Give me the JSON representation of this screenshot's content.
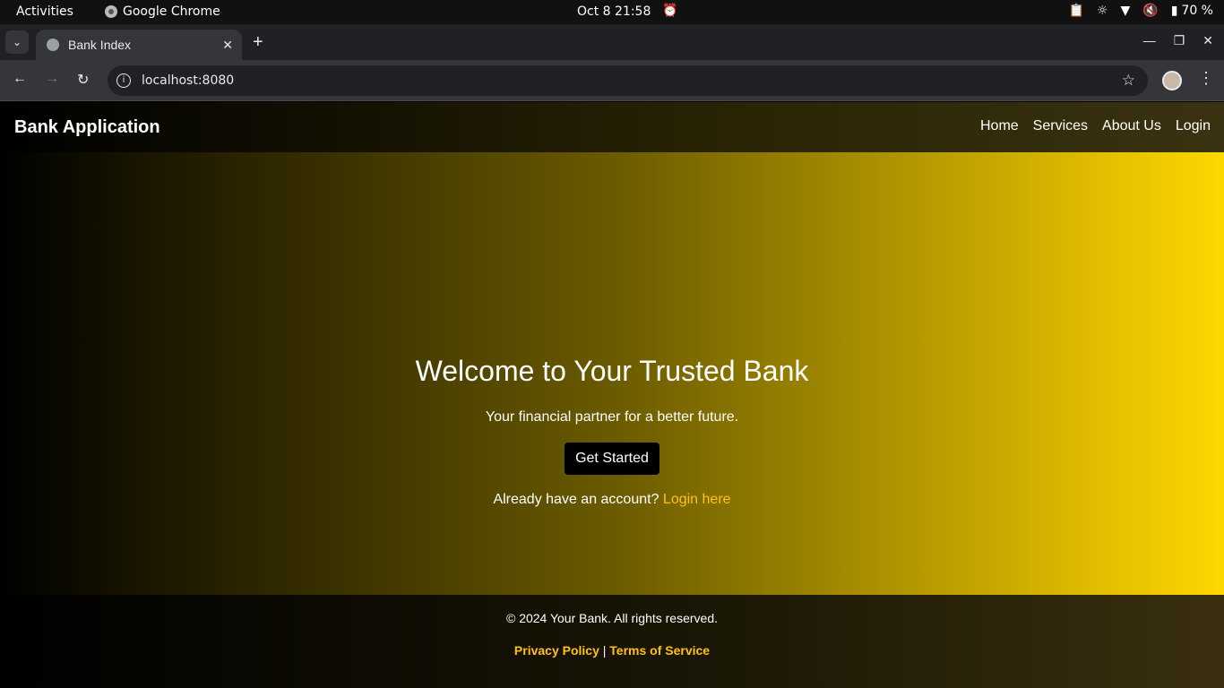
{
  "system": {
    "activities": "Activities",
    "app_name": "Google Chrome",
    "clock": "Oct 8  21:58",
    "battery": "70 %"
  },
  "browser": {
    "tab_title": "Bank Index",
    "url": "localhost:8080"
  },
  "site": {
    "brand": "Bank Application",
    "nav": [
      "Home",
      "Services",
      "About Us",
      "Login"
    ],
    "hero": {
      "title": "Welcome to Your Trusted Bank",
      "tagline": "Your financial partner for a better future.",
      "cta": "Get Started",
      "account_prompt": "Already have an account?",
      "login_link": "Login here"
    },
    "footer": {
      "copyright": "© 2024 Your Bank. All rights reserved.",
      "privacy": "Privacy Policy",
      "separator": "|",
      "terms": "Terms of Service"
    }
  },
  "colors": {
    "accent_gold": "#ffd700",
    "link_gold": "#ffc20e"
  }
}
